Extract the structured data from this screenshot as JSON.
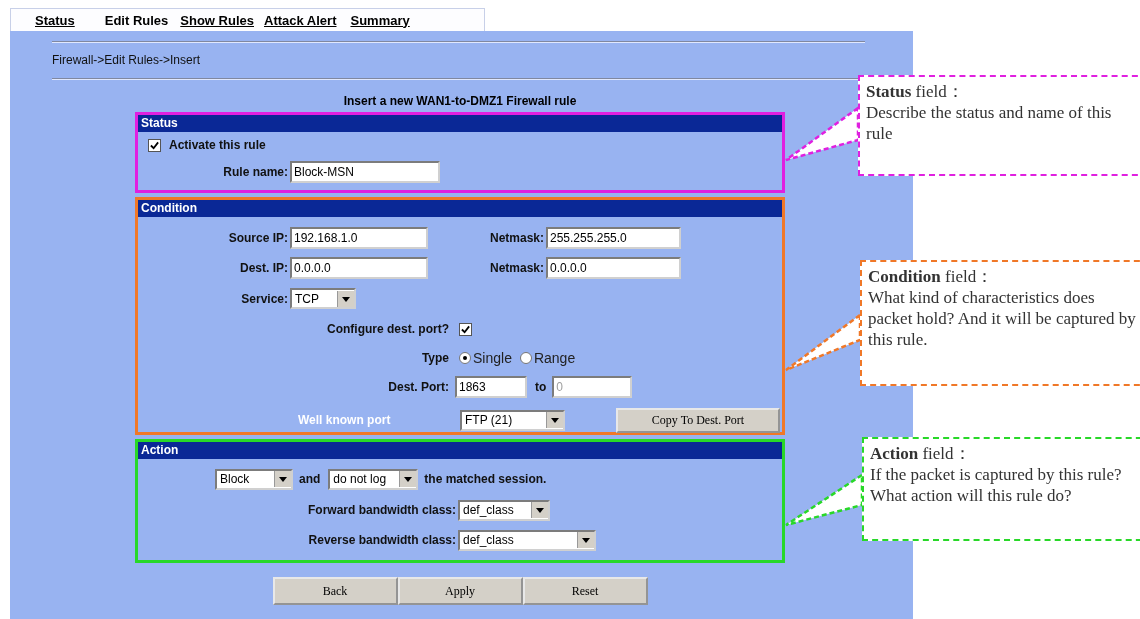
{
  "tabs": [
    {
      "label": "Status",
      "selected": false
    },
    {
      "label": "Edit Rules",
      "selected": true
    },
    {
      "label": "Show Rules",
      "selected": false
    },
    {
      "label": "Attack Alert",
      "selected": false
    },
    {
      "label": "Summary",
      "selected": false
    }
  ],
  "breadcrumb": "Firewall->Edit Rules->Insert",
  "form_title": "Insert a new WAN1-to-DMZ1 Firewall rule",
  "status": {
    "header": "Status",
    "activate": {
      "label": "Activate this rule",
      "checked": true
    },
    "rule_name": {
      "label": "Rule name:",
      "value": "Block-MSN"
    }
  },
  "condition": {
    "header": "Condition",
    "source_ip": {
      "label": "Source IP:",
      "value": "192.168.1.0"
    },
    "source_netmask": {
      "label": "Netmask:",
      "value": "255.255.255.0"
    },
    "dest_ip": {
      "label": "Dest. IP:",
      "value": "0.0.0.0"
    },
    "dest_netmask": {
      "label": "Netmask:",
      "value": "0.0.0.0"
    },
    "service": {
      "label": "Service:",
      "value": "TCP"
    },
    "configure_dest_port": {
      "label": "Configure dest. port?",
      "checked": true
    },
    "type": {
      "label": "Type",
      "options": [
        {
          "label": "Single",
          "selected": true
        },
        {
          "label": "Range",
          "selected": false
        }
      ]
    },
    "dest_port": {
      "label": "Dest. Port:",
      "value": "1863"
    },
    "to": {
      "label": "to",
      "value": "0",
      "disabled": true
    },
    "well_known_port": {
      "label": "Well known port",
      "value": "FTP (21)"
    },
    "copy_button": "Copy To Dest. Port"
  },
  "action": {
    "header": "Action",
    "action_value": "Block",
    "and_text": "and",
    "log_value": "do not log",
    "suffix": "the matched session.",
    "forward": {
      "label": "Forward bandwidth class:",
      "value": "def_class"
    },
    "reverse": {
      "label": "Reverse bandwidth class:",
      "value": "def_class"
    }
  },
  "buttons": [
    "Back",
    "Apply",
    "Reset"
  ],
  "callouts": [
    {
      "title": "**Status** field：",
      "text": "Describe the status and name of this rule",
      "color": "#e020e0"
    },
    {
      "title": "**Condition** field：",
      "text": "What kind of characteristics does packet hold? And it will be captured by this rule.",
      "color": "#f07828"
    },
    {
      "title": "**Action** field：",
      "text": "If the packet is captured by this rule? What action will this rule do?",
      "color": "#28d828"
    }
  ]
}
